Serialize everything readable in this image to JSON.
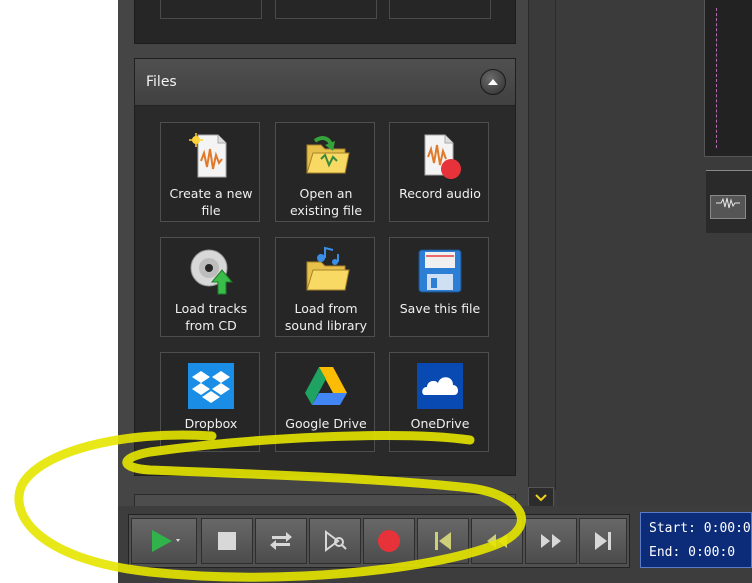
{
  "files_panel": {
    "title": "Files",
    "collapse_icon": "chevron-up-icon",
    "tiles": [
      {
        "label": "Create a new\nfile",
        "icon": "new-audio-file-icon"
      },
      {
        "label": "Open an\nexisting file",
        "icon": "open-folder-icon"
      },
      {
        "label": "Record audio",
        "icon": "record-audio-icon"
      },
      {
        "label": "Load tracks\nfrom CD",
        "icon": "cd-load-icon"
      },
      {
        "label": "Load from\nsound library",
        "icon": "sound-library-icon"
      },
      {
        "label": "Save this file",
        "icon": "floppy-disk-icon"
      },
      {
        "label": "Dropbox",
        "icon": "dropbox-icon"
      },
      {
        "label": "Google Drive",
        "icon": "google-drive-icon"
      },
      {
        "label": "OneDrive",
        "icon": "onedrive-icon"
      }
    ]
  },
  "transport": {
    "buttons": [
      "play-icon",
      "stop-icon",
      "loop-icon",
      "scrub-icon",
      "record-icon",
      "go-to-start-icon",
      "rewind-icon",
      "fast-forward-icon",
      "go-to-end-icon"
    ]
  },
  "time": {
    "start_label": "Start:",
    "start_value": "0:00:0",
    "end_label": "End:",
    "end_value": "0:00:0"
  },
  "colors": {
    "play_green": "#2fb34a",
    "record_red": "#e8323a",
    "time_bg": "#0c2c7a",
    "highlight_yellow": "#e6e600",
    "waveform_accent": "#b46bb4"
  }
}
